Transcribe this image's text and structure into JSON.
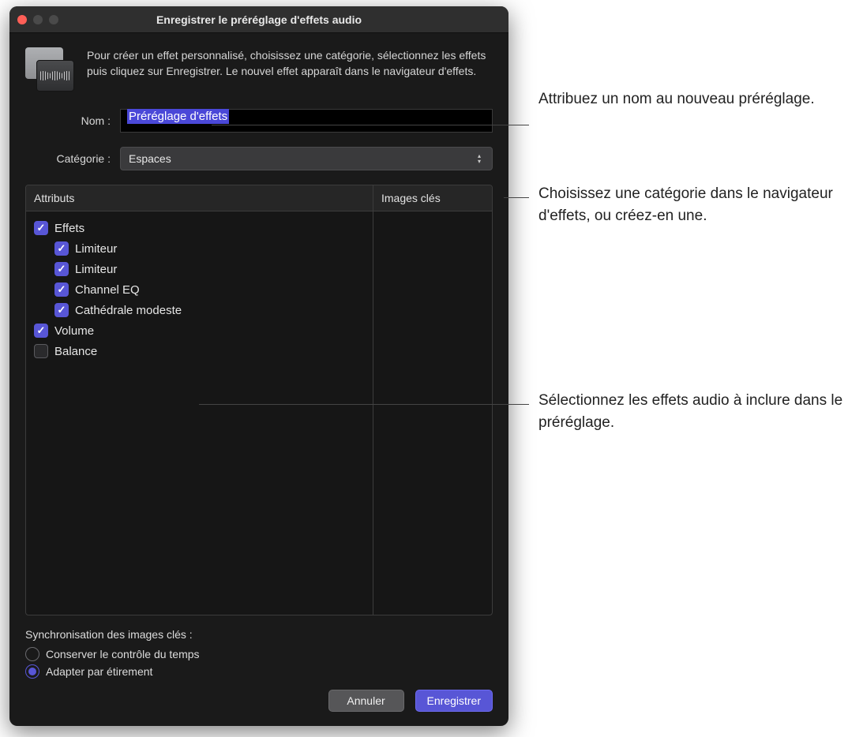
{
  "window": {
    "title": "Enregistrer le préréglage d'effets audio"
  },
  "intro": "Pour créer un effet personnalisé, choisissez une catégorie, sélectionnez les effets puis cliquez sur Enregistrer. Le nouvel effet apparaît dans le navigateur d'effets.",
  "form": {
    "name_label": "Nom :",
    "name_value": "Préréglage d'effets",
    "category_label": "Catégorie :",
    "category_value": "Espaces"
  },
  "tree": {
    "header_attrs": "Attributs",
    "header_keyframes": "Images clés",
    "items": [
      {
        "label": "Effets",
        "checked": true,
        "child": false
      },
      {
        "label": "Limiteur",
        "checked": true,
        "child": true
      },
      {
        "label": "Limiteur",
        "checked": true,
        "child": true
      },
      {
        "label": "Channel EQ",
        "checked": true,
        "child": true
      },
      {
        "label": "Cathédrale modeste",
        "checked": true,
        "child": true
      },
      {
        "label": "Volume",
        "checked": true,
        "child": false
      },
      {
        "label": "Balance",
        "checked": false,
        "child": false
      }
    ]
  },
  "sync": {
    "title": "Synchronisation des images clés :",
    "opt_maintain": "Conserver le contrôle du temps",
    "opt_stretch": "Adapter par étirement",
    "selected": "stretch"
  },
  "buttons": {
    "cancel": "Annuler",
    "save": "Enregistrer"
  },
  "callouts": {
    "c1": "Attribuez un nom au nouveau préréglage.",
    "c2": "Choisissez une catégorie dans le navigateur d'effets, ou créez-en une.",
    "c3": "Sélectionnez les effets audio à inclure dans le préréglage."
  }
}
